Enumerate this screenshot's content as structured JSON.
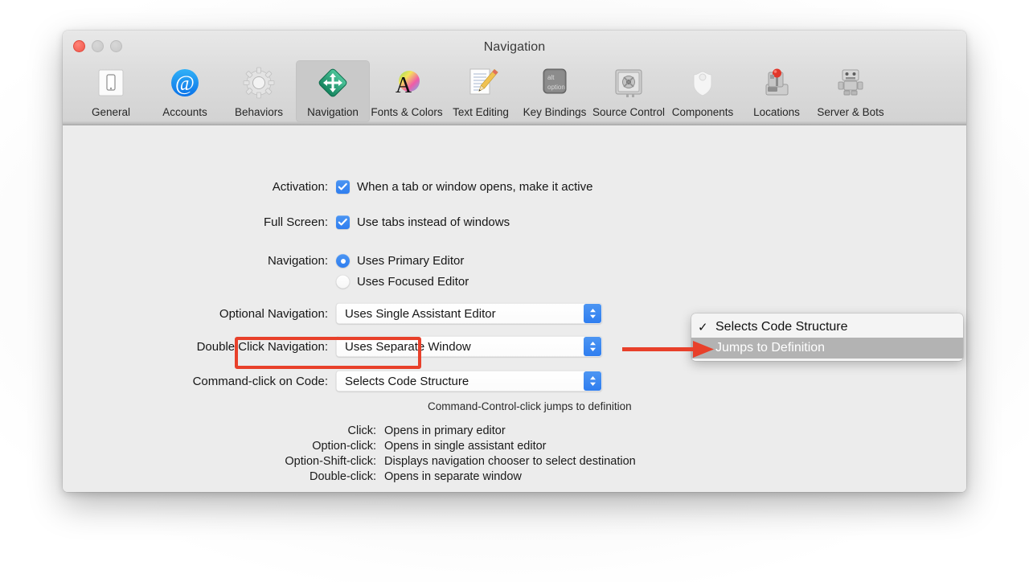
{
  "window": {
    "title": "Navigation",
    "traffic_lights": [
      "close-button",
      "minimize-button",
      "zoom-button"
    ]
  },
  "toolbar": {
    "items": [
      {
        "label": "General",
        "icon": "device-icon",
        "selected": false
      },
      {
        "label": "Accounts",
        "icon": "at-sign-icon",
        "selected": false
      },
      {
        "label": "Behaviors",
        "icon": "gear-icon",
        "selected": false
      },
      {
        "label": "Navigation",
        "icon": "move-arrows-icon",
        "selected": true
      },
      {
        "label": "Fonts & Colors",
        "icon": "font-color-icon",
        "selected": false
      },
      {
        "label": "Text Editing",
        "icon": "pencil-page-icon",
        "selected": false
      },
      {
        "label": "Key Bindings",
        "icon": "option-key-icon",
        "selected": false
      },
      {
        "label": "Source Control",
        "icon": "safe-icon",
        "selected": false
      },
      {
        "label": "Components",
        "icon": "shield-icon",
        "selected": false
      },
      {
        "label": "Locations",
        "icon": "joystick-disk-icon",
        "selected": false
      },
      {
        "label": "Server & Bots",
        "icon": "robot-icon",
        "selected": false
      }
    ]
  },
  "form": {
    "activation": {
      "label": "Activation:",
      "checkbox_label": "When a tab or window opens, make it active",
      "checked": true
    },
    "full_screen": {
      "label": "Full Screen:",
      "checkbox_label": "Use tabs instead of windows",
      "checked": true
    },
    "navigation": {
      "label": "Navigation:",
      "options": [
        "Uses Primary Editor",
        "Uses Focused Editor"
      ],
      "selected": "Uses Primary Editor"
    },
    "optional_navigation": {
      "label": "Optional Navigation:",
      "value": "Uses Single Assistant Editor"
    },
    "double_click_navigation": {
      "label": "Double Click Navigation:",
      "value": "Uses Separate Window"
    },
    "command_click_on_code": {
      "label": "Command-click on Code:",
      "value": "Selects Code Structure",
      "hint": "Command-Control-click jumps to definition"
    }
  },
  "dropdown_menu": {
    "items": [
      {
        "label": "Selects Code Structure",
        "checked": true,
        "highlighted": false
      },
      {
        "label": "Jumps to Definition",
        "checked": false,
        "highlighted": true
      }
    ],
    "check_glyph": "✓"
  },
  "legend": {
    "rows": [
      {
        "key": "Click:",
        "value": "Opens in primary editor"
      },
      {
        "key": "Option-click:",
        "value": "Opens in single assistant editor"
      },
      {
        "key": "Option-Shift-click:",
        "value": "Displays navigation chooser to select destination"
      },
      {
        "key": "Double-click:",
        "value": "Opens in separate window"
      }
    ]
  },
  "annotations": {
    "highlight_box_target": "Command-click on Code:",
    "arrow_target": "Jumps to Definition",
    "color": "#e8402a"
  }
}
